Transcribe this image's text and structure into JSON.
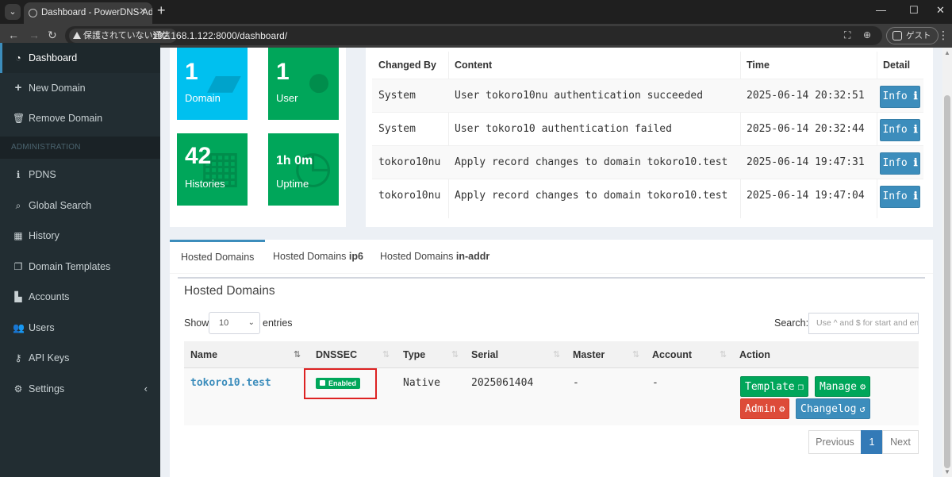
{
  "browser": {
    "tab_title": "Dashboard - PowerDNS-Admin",
    "security_label": "保護されていない通信",
    "url": "192.168.1.122:8000/dashboard/",
    "guest_label": "ゲスト"
  },
  "sidebar": {
    "items_top": [
      {
        "label": "Dashboard",
        "icon": "dashboard-icon"
      },
      {
        "label": "New Domain",
        "icon": "plus-icon"
      },
      {
        "label": "Remove Domain",
        "icon": "trash-icon"
      }
    ],
    "header": "ADMINISTRATION",
    "items_admin": [
      {
        "label": "PDNS",
        "icon": "info-icon"
      },
      {
        "label": "Global Search",
        "icon": "search-icon"
      },
      {
        "label": "History",
        "icon": "calendar-icon"
      },
      {
        "label": "Domain Templates",
        "icon": "clone-icon"
      },
      {
        "label": "Accounts",
        "icon": "industry-icon"
      },
      {
        "label": "Users",
        "icon": "users-icon"
      },
      {
        "label": "API Keys",
        "icon": "key-icon"
      },
      {
        "label": "Settings",
        "icon": "cog-icon"
      }
    ]
  },
  "stats": [
    {
      "value": "1",
      "label": "Domain",
      "color": "#00c0ef"
    },
    {
      "value": "1",
      "label": "User",
      "color": "#00a65a"
    },
    {
      "value": "42",
      "label": "Histories",
      "color": "#00a65a"
    },
    {
      "value": "1h 0m",
      "label": "Uptime",
      "color": "#00a65a"
    }
  ],
  "history": {
    "columns": [
      "Changed By",
      "Content",
      "Time",
      "Detail"
    ],
    "rows": [
      {
        "by": "System",
        "content": "User tokoro10nu authentication succeeded",
        "time": "2025-06-14 20:32:51",
        "detail": "Info"
      },
      {
        "by": "System",
        "content": "User tokoro10 authentication failed",
        "time": "2025-06-14 20:32:44",
        "detail": "Info"
      },
      {
        "by": "tokoro10nu",
        "content": "Apply record changes to domain tokoro10.test",
        "time": "2025-06-14 19:47:31",
        "detail": "Info"
      },
      {
        "by": "tokoro10nu",
        "content": "Apply record changes to domain tokoro10.test",
        "time": "2025-06-14 19:47:04",
        "detail": "Info"
      }
    ]
  },
  "tabs": [
    {
      "label": "Hosted Domains",
      "bold": ""
    },
    {
      "label": "Hosted Domains ",
      "bold": "ip6"
    },
    {
      "label": "Hosted Domains ",
      "bold": "in-addr"
    }
  ],
  "domains": {
    "title": "Hosted Domains",
    "show_label": "Show",
    "entries_label": "entries",
    "page_size": "10",
    "search_label": "Search:",
    "search_placeholder": "Use ^ and $ for start and end",
    "columns": [
      "Name",
      "DNSSEC",
      "Type",
      "Serial",
      "Master",
      "Account",
      "Action"
    ],
    "rows": [
      {
        "name": "tokoro10.test",
        "dnssec": "Enabled",
        "type": "Native",
        "serial": "2025061404",
        "master": "-",
        "account": "-"
      }
    ],
    "actions": {
      "template": "Template",
      "manage": "Manage",
      "admin": "Admin",
      "changelog": "Changelog"
    },
    "pagination": {
      "previous": "Previous",
      "page": "1",
      "next": "Next"
    }
  }
}
